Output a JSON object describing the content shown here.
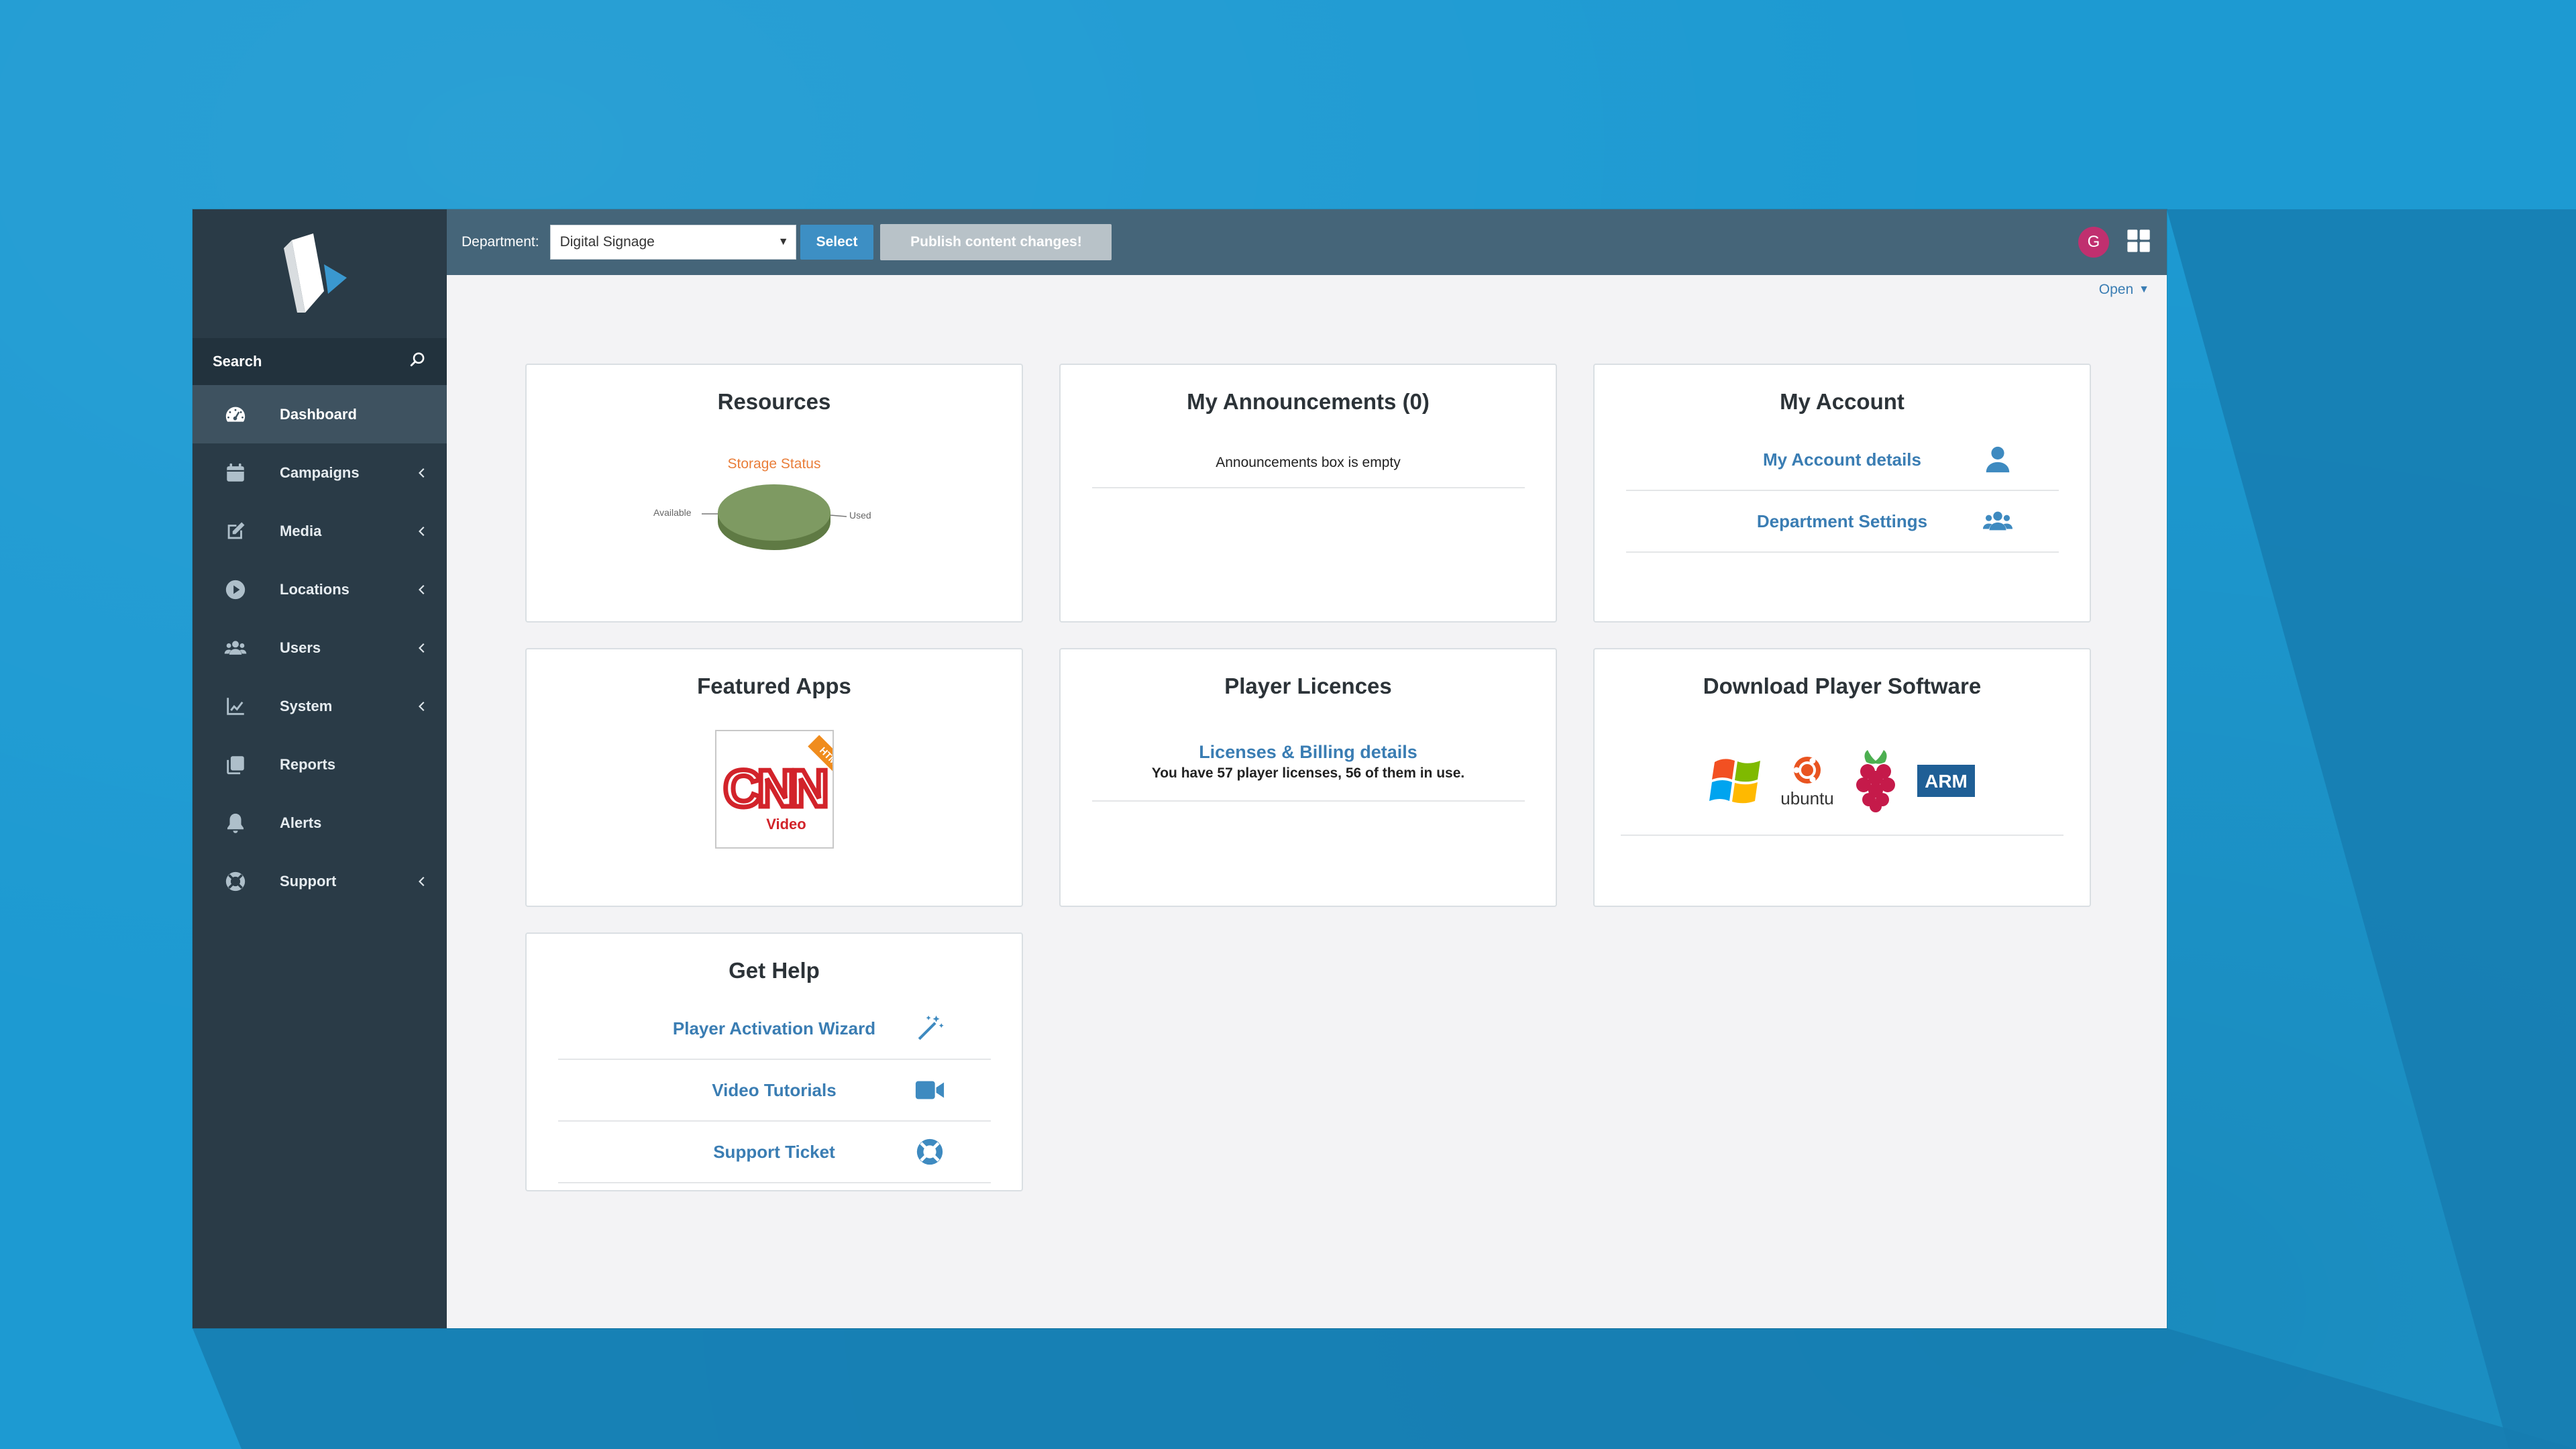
{
  "sidebar": {
    "search_label": "Search",
    "items": [
      {
        "label": "Dashboard",
        "icon": "dashboard-icon",
        "active": true,
        "has_chevron": false
      },
      {
        "label": "Campaigns",
        "icon": "calendar-icon",
        "has_chevron": true
      },
      {
        "label": "Media",
        "icon": "edit-icon",
        "has_chevron": true
      },
      {
        "label": "Locations",
        "icon": "play-icon",
        "has_chevron": true
      },
      {
        "label": "Users",
        "icon": "users-icon",
        "has_chevron": true
      },
      {
        "label": "System",
        "icon": "chart-icon",
        "has_chevron": true
      },
      {
        "label": "Reports",
        "icon": "copy-icon",
        "has_chevron": false
      },
      {
        "label": "Alerts",
        "icon": "bell-icon",
        "has_chevron": false
      },
      {
        "label": "Support",
        "icon": "lifebuoy-icon",
        "has_chevron": true
      }
    ]
  },
  "topbar": {
    "department_label": "Department:",
    "department_value": "Digital Signage",
    "select_button": "Select",
    "publish_button": "Publish content changes!",
    "avatar_letter": "G"
  },
  "content": {
    "open_link": "Open"
  },
  "cards": {
    "resources": {
      "title": "Resources",
      "storage_title": "Storage Status",
      "available_label": "Available",
      "used_label": "Used"
    },
    "announcements": {
      "title": "My Announcements (0)",
      "empty_text": "Announcements box is empty"
    },
    "account": {
      "title": "My Account",
      "details_link": "My Account details",
      "settings_link": "Department Settings"
    },
    "featured": {
      "title": "Featured Apps",
      "app_name": "CNN",
      "app_sub": "Video",
      "app_badge": "HTML5"
    },
    "licences": {
      "title": "Player Licences",
      "billing_link": "Licenses & Billing details",
      "summary": "You have 57 player licenses, 56 of them in use."
    },
    "download": {
      "title": "Download Player Software",
      "ubuntu_label": "ubuntu",
      "arm_label": "ARM"
    },
    "help": {
      "title": "Get Help",
      "wizard_link": "Player Activation Wizard",
      "tutorials_link": "Video Tutorials",
      "ticket_link": "Support Ticket"
    }
  },
  "colors": {
    "background": "#1d9ad2",
    "sidebar": "#2a3b47",
    "topbar": "#456579",
    "accent": "#3a7db3",
    "storage_title": "#e97e3a",
    "avatar": "#c0306f"
  }
}
